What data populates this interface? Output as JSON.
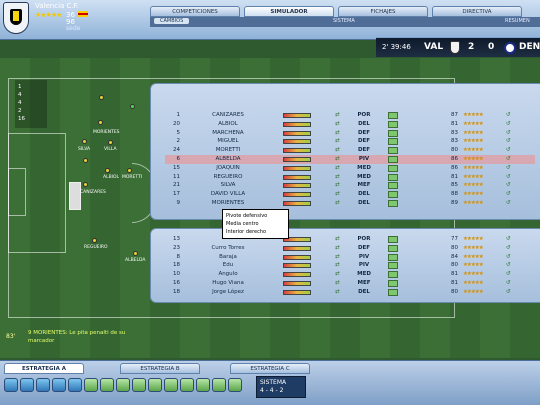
{
  "header": {
    "club_name": "Valencia C.F.",
    "stars": "★★★★★",
    "score_small": "36",
    "score_small2": "96",
    "subtext": "sede"
  },
  "tabs": [
    {
      "label": "COMPETICIONES",
      "active": false
    },
    {
      "label": "SIMULADOR",
      "active": true
    },
    {
      "label": "FICHAJES",
      "active": false
    },
    {
      "label": "DIRECTIVA",
      "active": false
    }
  ],
  "subtabs": {
    "cambios": "CAMBIOS",
    "sistema": "SISTEMA",
    "resumen": "RESUMEN"
  },
  "scoreboard": {
    "clock": "2' 39:46",
    "home": "VAL",
    "home_score": "2",
    "away": "DEN",
    "away_score": "0"
  },
  "formation_list": [
    "1",
    "4",
    "4",
    "2",
    "16"
  ],
  "starters": [
    {
      "num": "1",
      "name": "CANIZARES",
      "pos": "POR",
      "rating": "87"
    },
    {
      "num": "20",
      "name": "ALBIOL",
      "pos": "DEL",
      "rating": "81"
    },
    {
      "num": "5",
      "name": "MARCHENA",
      "pos": "DEF",
      "rating": "83"
    },
    {
      "num": "2",
      "name": "MIGUEL",
      "pos": "DEF",
      "rating": "83"
    },
    {
      "num": "24",
      "name": "MORETTI",
      "pos": "DEF",
      "rating": "80"
    },
    {
      "num": "6",
      "name": "ALBELDA",
      "pos": "PIV",
      "rating": "86"
    },
    {
      "num": "15",
      "name": "JOAQUIN",
      "pos": "MED",
      "rating": "86"
    },
    {
      "num": "11",
      "name": "REGUEIRO",
      "pos": "MED",
      "rating": "81"
    },
    {
      "num": "21",
      "name": "SILVA",
      "pos": "MEF",
      "rating": "85"
    },
    {
      "num": "17",
      "name": "DAVID VILLA",
      "pos": "DEL",
      "rating": "88"
    },
    {
      "num": "9",
      "name": "MORIENTES",
      "pos": "DEL",
      "rating": "89"
    }
  ],
  "subs": [
    {
      "num": "13",
      "name": "",
      "pos": "POR",
      "rating": "77"
    },
    {
      "num": "23",
      "name": "Curro Torres",
      "pos": "DEF",
      "rating": "80"
    },
    {
      "num": "8",
      "name": "Baraja",
      "pos": "PIV",
      "rating": "84"
    },
    {
      "num": "18",
      "name": "Edu",
      "pos": "PIV",
      "rating": "80"
    },
    {
      "num": "10",
      "name": "Angulo",
      "pos": "MED",
      "rating": "81"
    },
    {
      "num": "16",
      "name": "Hugo Viana",
      "pos": "MEF",
      "rating": "81"
    },
    {
      "num": "18",
      "name": "Jorge López",
      "pos": "DEL",
      "rating": "80"
    }
  ],
  "rating_stars": "★★★★★",
  "tooltip": [
    "Pivote defensivo",
    "Media centro",
    "Interior derecho"
  ],
  "message": {
    "time": "83'",
    "text": "9 MORIENTES: Le pita penalti de su marcador"
  },
  "bottom_tabs": [
    "ESTRATEGIA A",
    "ESTRATEGIA B",
    "ESTRATEGIA C"
  ],
  "system": {
    "label": "SISTEMA",
    "value": "4 - 4 - 2"
  },
  "pitch_labels": [
    "MORIENTES",
    "VILLA",
    "SILVA",
    "ALBIOL",
    "MORETTI",
    "CANIZARES",
    "REGUEIRO",
    "ALBELDA",
    "MARCHENA",
    "MIGUEL",
    "JOAQUIN"
  ],
  "colors": {
    "accent": "#506d97",
    "pitch": "#3b6f36",
    "highlight": "#d7a7b2"
  }
}
